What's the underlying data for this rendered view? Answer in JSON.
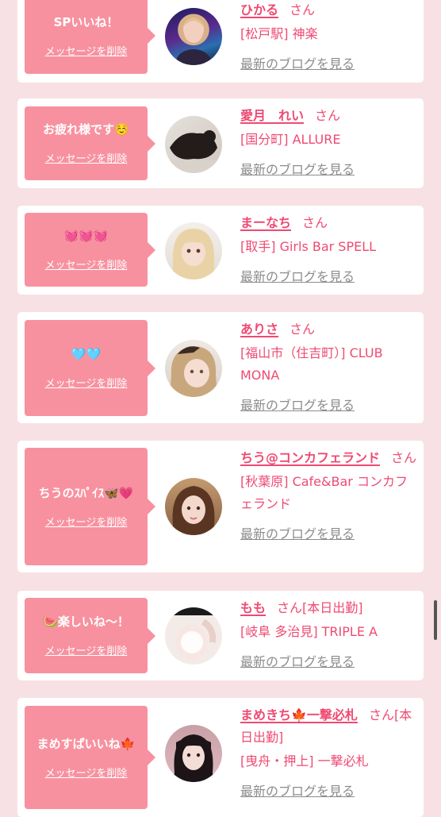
{
  "delete_label": "メッセージを削除",
  "blog_label": "最新のブログを見る",
  "san_label": "さん",
  "accent_color": "#ef4a72",
  "bubble_color": "#f8919f",
  "items": [
    {
      "message": "SPいいね！",
      "name": "ひかる",
      "status": "",
      "shop": "[松戸駅] 神楽"
    },
    {
      "message": "お疲れ様です☺️",
      "name": "愛月　れい",
      "status": "",
      "shop": "[国分町] ALLURE"
    },
    {
      "message": "💓💓💓",
      "name": "まーなち",
      "status": "",
      "shop": "[取手] Girls Bar SPELL"
    },
    {
      "message": "🩵🩵",
      "name": "ありさ",
      "status": "",
      "shop": "[福山市（住吉町）] CLUB MONA"
    },
    {
      "message": "ちうのｽﾊﾟｲｽ🦋💗",
      "name": "ちう@コンカフェランド",
      "status": "",
      "shop": "[秋葉原] Cafe&Bar コンカフェランド"
    },
    {
      "message": "🍉楽しいね〜！",
      "name": "もも",
      "status": "[本日出勤]",
      "shop": "[岐阜 多治見] TRIPLE A"
    },
    {
      "message": "まめすぱいいね🍁",
      "name": "まめきち🍁一撃必札",
      "status": "[本日出勤]",
      "shop": "[曳舟・押上] 一撃必札"
    }
  ]
}
